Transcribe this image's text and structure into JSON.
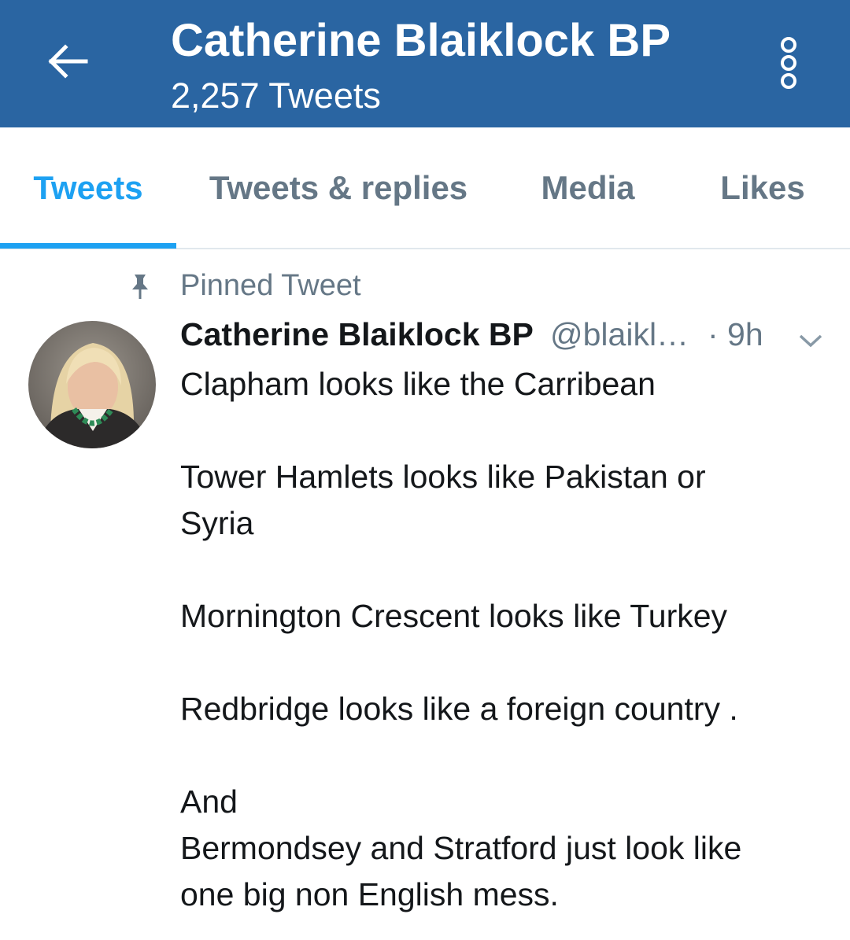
{
  "header": {
    "title": "Catherine Blaiklock BP",
    "subtitle": "2,257 Tweets",
    "background_color": "#2a65a2",
    "back_icon": "arrow-left-icon",
    "more_icon": "more-vertical-icon"
  },
  "tabs": [
    {
      "label": "Tweets",
      "active": true
    },
    {
      "label": "Tweets & replies",
      "active": false
    },
    {
      "label": "Media",
      "active": false
    },
    {
      "label": "Likes",
      "active": false
    }
  ],
  "accent_color": "#1da1f2",
  "tweet": {
    "pinned_label": "Pinned Tweet",
    "pin_icon": "pin-icon",
    "author_name": "Catherine Blaiklock BP",
    "handle": "@blaikl…",
    "time": "· 9h",
    "caret_icon": "chevron-down-icon",
    "lines": [
      "Clapham looks like the Carribean",
      "",
      "Tower Hamlets looks like Pakistan or",
      "Syria",
      "",
      "Mornington Crescent looks like Turkey",
      "",
      "Redbridge looks like a foreign country .",
      "",
      "And",
      "Bermondsey and Stratford just look like",
      "one big non English mess."
    ]
  }
}
